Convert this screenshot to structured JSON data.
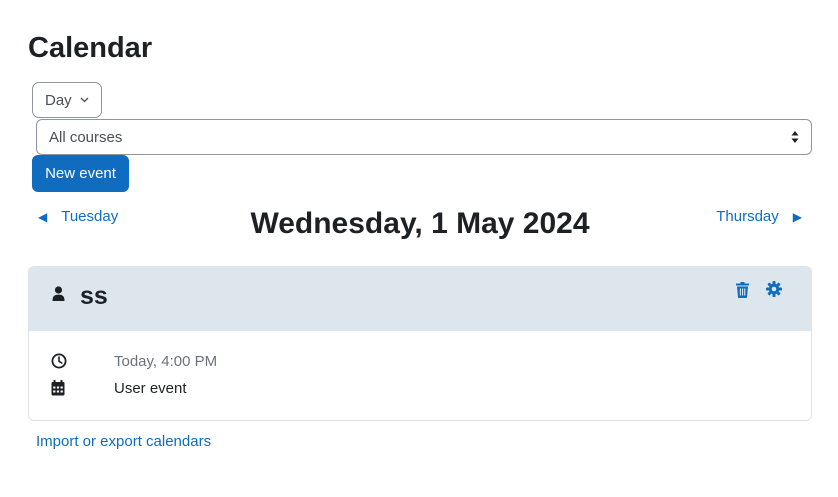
{
  "page": {
    "title": "Calendar"
  },
  "toolbar": {
    "view_selected": "Day",
    "course_filter": "All courses",
    "new_event_label": "New event"
  },
  "day_nav": {
    "prev_label": "Tuesday",
    "current_day": "Wednesday, 1 May 2024",
    "next_label": "Thursday"
  },
  "event": {
    "name": "ss",
    "time": "Today, 4:00 PM",
    "type": "User event"
  },
  "footer": {
    "import_export_label": "Import or export calendars"
  },
  "icons": {
    "view_dropdown": "chevron-down-icon",
    "course_select": "sort-updown-icon",
    "prev": "triangle-left-icon",
    "next": "triangle-right-icon",
    "event_owner": "user-icon",
    "delete": "trash-icon",
    "edit": "gear-icon",
    "time": "clock-icon",
    "type": "calendar-icon"
  },
  "colors": {
    "primary": "#0f6cbf",
    "event_header_bg": "#dce6ec",
    "text": "#1d2125",
    "muted_text": "#6a737b",
    "border": "#8f959e"
  }
}
